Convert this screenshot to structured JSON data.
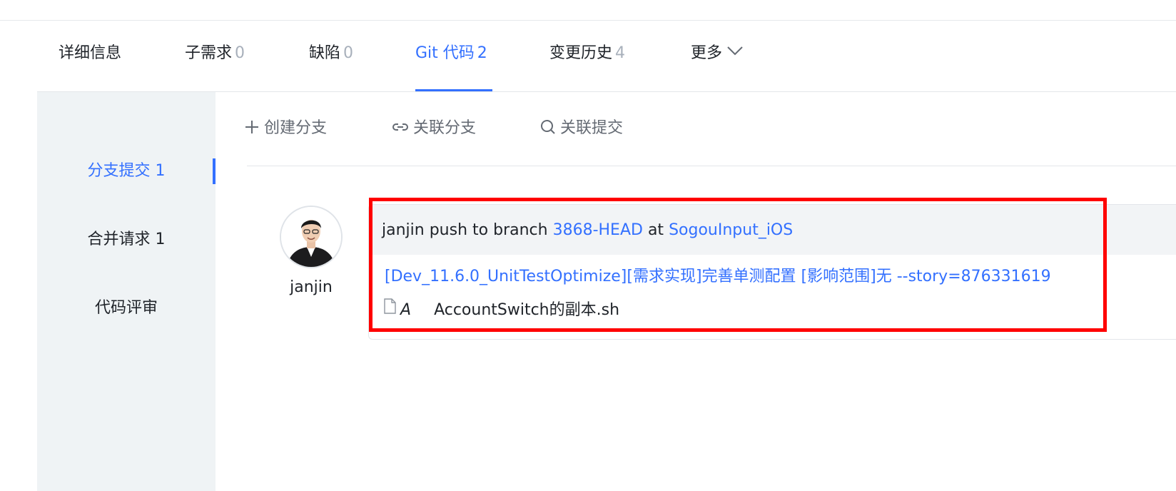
{
  "tabs": [
    {
      "label": "详细信息",
      "count": ""
    },
    {
      "label": "子需求",
      "count": "0"
    },
    {
      "label": "缺陷",
      "count": "0"
    },
    {
      "label": "Git 代码",
      "count": "2"
    },
    {
      "label": "变更历史",
      "count": "4"
    },
    {
      "label": "更多",
      "count": ""
    }
  ],
  "active_tab": "Git 代码",
  "subnav": {
    "items": [
      {
        "label": "分支提交 1"
      },
      {
        "label": "合并请求 1"
      },
      {
        "label": "代码评审"
      }
    ],
    "active": "分支提交 1"
  },
  "toolbar": {
    "create_branch": "创建分支",
    "link_branch": "关联分支",
    "link_commit": "关联提交"
  },
  "commit": {
    "author": "janjin",
    "head_user": "janjin",
    "head_action": "push to branch",
    "branch": "3868-HEAD",
    "head_at": "at",
    "repo": "SogouInput_iOS",
    "message": "[Dev_11.6.0_UnitTestOptimize][需求实现]完善单测配置 [影响范围]无 --story=876331619",
    "files": [
      {
        "status": "A",
        "name": "AccountSwitch的副本.sh"
      }
    ]
  },
  "colors": {
    "accent": "#3370ff",
    "highlight": "#ff0000",
    "sidebar_bg": "#eff3f5",
    "muted_count": "#a8b0bb"
  }
}
